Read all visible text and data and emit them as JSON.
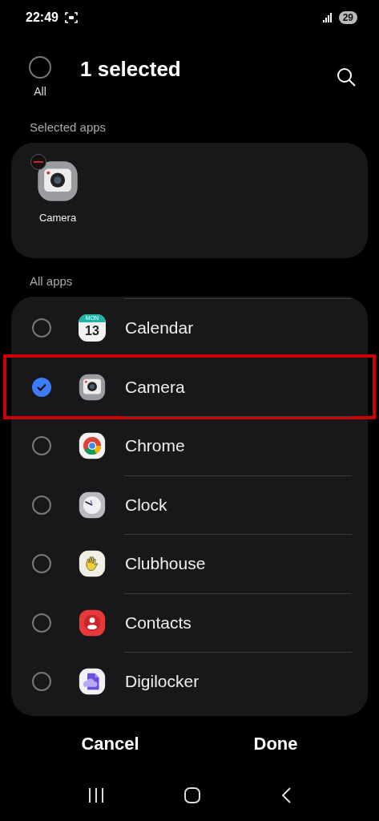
{
  "status_bar": {
    "time": "22:49",
    "battery": "29"
  },
  "header": {
    "all_label": "All",
    "all_checked": false,
    "title": "1 selected"
  },
  "selected_section": {
    "label": "Selected apps",
    "apps": [
      {
        "name": "Camera",
        "kind": "camera"
      }
    ]
  },
  "all_section": {
    "label": "All apps",
    "apps": [
      {
        "name": "Calendar",
        "kind": "calendar",
        "icon_day": "MON",
        "icon_date": "13",
        "checked": false,
        "highlighted": false
      },
      {
        "name": "Camera",
        "kind": "camera",
        "checked": true,
        "highlighted": true
      },
      {
        "name": "Chrome",
        "kind": "chrome",
        "checked": false,
        "highlighted": false
      },
      {
        "name": "Clock",
        "kind": "clock",
        "checked": false,
        "highlighted": false
      },
      {
        "name": "Clubhouse",
        "kind": "clubhouse",
        "checked": false,
        "highlighted": false
      },
      {
        "name": "Contacts",
        "kind": "contacts",
        "checked": false,
        "highlighted": false
      },
      {
        "name": "Digilocker",
        "kind": "digilocker",
        "checked": false,
        "highlighted": false
      }
    ]
  },
  "buttons": [
    "Cancel",
    "Done"
  ]
}
